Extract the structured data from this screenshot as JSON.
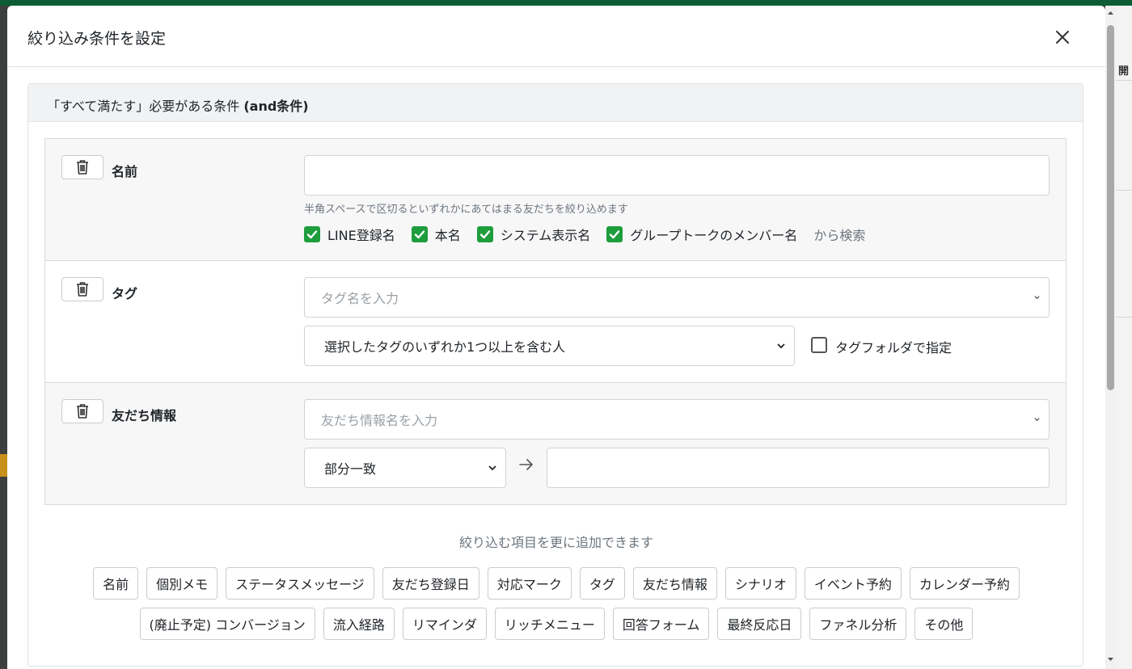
{
  "modal": {
    "title": "絞り込み条件を設定"
  },
  "and_group": {
    "header_prefix": "「すべて満たす」必要がある条件 ",
    "header_bold": "(and条件)"
  },
  "conditions": {
    "name": {
      "label": "名前",
      "input_value": "",
      "help": "半角スペースで区切るといずれかにあてはまる友だちを絞り込めます",
      "checks": [
        "LINE登録名",
        "本名",
        "システム表示名",
        "グループトークのメンバー名"
      ],
      "suffix": "から検索"
    },
    "tag": {
      "label": "タグ",
      "placeholder": "タグ名を入力",
      "match_select": "選択したタグのいずれか1つ以上を含む人",
      "folder_label": "タグフォルダで指定"
    },
    "friend_info": {
      "label": "友だち情報",
      "placeholder": "友だち情報名を入力",
      "match_select": "部分一致",
      "value": ""
    }
  },
  "add_section": {
    "hint": "絞り込む項目を更に追加できます",
    "row1": [
      "名前",
      "個別メモ",
      "ステータスメッセージ",
      "友だち登録日",
      "対応マーク",
      "タグ",
      "友だち情報",
      "シナリオ",
      "イベント予約",
      "カレンダー予約"
    ],
    "row2": [
      "(廃止予定) コンバージョン",
      "流入経路",
      "リマインダ",
      "リッチメニュー",
      "回答フォーム",
      "最終反応日",
      "ファネル分析",
      "その他"
    ]
  },
  "background": {
    "right_edge_text": "開"
  },
  "colors": {
    "check_green": "#1e9d3c",
    "top_bar": "#0c5d36",
    "header_bg": "#f1f2f3"
  }
}
